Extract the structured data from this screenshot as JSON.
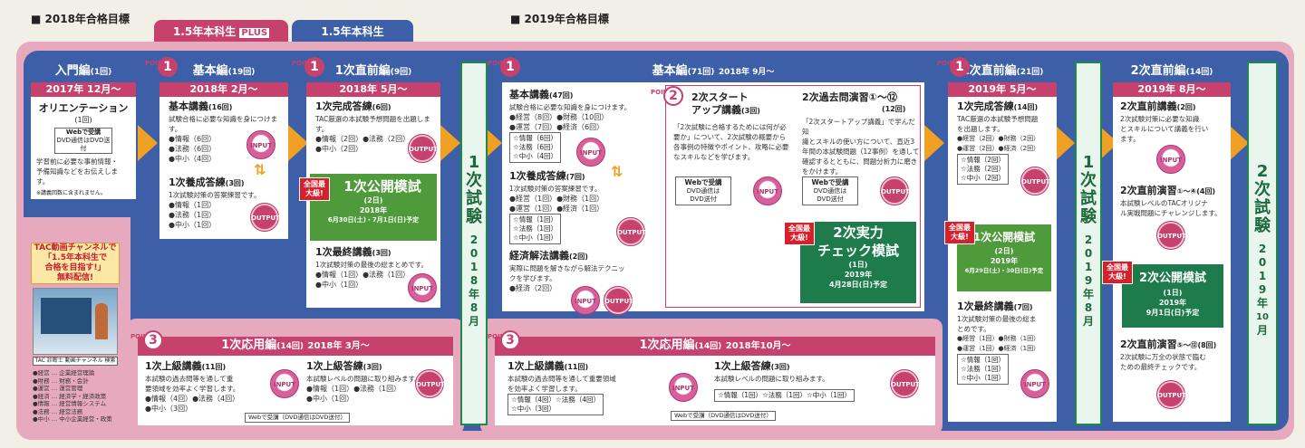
{
  "headers": {
    "h2018": "■ 2018年合格目標",
    "h2019": "■ 2019年合格目標"
  },
  "tabs": {
    "plus_pre": "1.5年本科生",
    "plus_badge": "PLUS",
    "basic": "1.5年本科生"
  },
  "point_label": "POINT",
  "icons": {
    "input": "INPUT",
    "output": "OUTPUT"
  },
  "nyumon": {
    "title": "入門編",
    "count": "(1回)",
    "date": "2017年 12月～",
    "sub_title": "オリエンテーション",
    "sub_count": "(1回)",
    "web": "Webで受講",
    "web2": "DVD通信はDVD送付",
    "desc1": "学習前に必要な事前情報・",
    "desc2": "予備知識などをお伝えします。",
    "note": "※講義回数に含まれません。"
  },
  "kiso2018": {
    "point": "1",
    "title": "基本編",
    "count": "(19回)",
    "date": "2018年 2月～",
    "lec_title": "基本講義",
    "lec_count": "(16回)",
    "lec_desc": "試験合格に必要な知識を身につけます。",
    "lec_items": [
      "●情報（6回）",
      "●法務（6回）",
      "●中小（4回）"
    ],
    "ans_title": "1次養成答練",
    "ans_count": "(3回)",
    "ans_desc": "1次試験対策の答案練習です。",
    "ans_items": [
      "●情報（1回）",
      "●法務（1回）",
      "●中小（1回）"
    ]
  },
  "chokuzen2018": {
    "point": "1",
    "title": "1次直前編",
    "count": "(9回)",
    "date": "2018年 5月～",
    "t1": "1次完成答練",
    "c1": "(6回)",
    "d1": "TAC厳選の本試験予想問題を出題します。",
    "i1": "●情報（2回）●法務（2回）",
    "i1b": "●中小（2回）",
    "mock_tag": "全国最大級!",
    "mock": "1次公開模試",
    "mock_count": "(2日)",
    "mock_year": "2018年",
    "mock_date": "6月30日(土)・7月1日(日)予定",
    "t2": "1次最終講義",
    "c2": "(3回)",
    "d2": "1次試験対策の最後の総まとめです。",
    "i2": "●情報（1回）●法務（1回）",
    "i2b": "●中小（1回）"
  },
  "exam1_2018": {
    "a": "1",
    "b": "次",
    "c": "試",
    "d": "験",
    "e": "2",
    "f": "0",
    "g": "1",
    "h": "8",
    "i": "年",
    "j": "8",
    "k": "月"
  },
  "kiso2019": {
    "point": "1",
    "title": "基本編",
    "count": "(71回)",
    "date": "2018年 9月～",
    "t1": "基本講義",
    "c1": "(47回)",
    "d1": "試験合格に必要な知識を身につけます。",
    "i1": "●経営（8回）●財務（10回）",
    "i1b": "●運営（7回）●経済（6回）",
    "bx1": [
      "☆情報（6回）",
      "☆法務（6回）",
      "☆中小（4回）"
    ],
    "t2": "1次養成答練",
    "c2": "(7回)",
    "d2": "1次試験対策の答案練習です。",
    "i2": "●経営（1回）●財務（1回）",
    "i2b": "●運営（1回）●経済（1回）",
    "bx2": [
      "☆情報（1回）",
      "☆法務（1回）",
      "☆中小（1回）"
    ],
    "t3": "経済解法講義",
    "c3": "(2回)",
    "d3a": "実際に問題を解きながら解法テクニッ",
    "d3b": "クを学びます。",
    "i3": "●経済（2回）",
    "p2": "2",
    "st_title": "2次スタート",
    "st_title2": "アップ講義",
    "st_count": "(3回)",
    "st_d": [
      "「2次試験に合格するためには何が必",
      "要か」について、2次試験の概要から",
      "各事例の特徴やポイント、攻略に必要",
      "なスキルなどを学びます。"
    ],
    "web": "Webで受講",
    "web2": "DVD通信は",
    "web3": "DVD送付",
    "kk_title": "2次過去問演習①～⑫",
    "kk_count": "(12回)",
    "kk_d": [
      "「2次スタートアップ講義」で学んだ知",
      "識とスキルの使い方について、直近3",
      "年間の本試験問題（12事例）を通して",
      "確認するとともに、問題分析力に磨き",
      "をかけます。"
    ],
    "j_tag": "全国最大級!",
    "j1": "2次実力",
    "j2": "チェック模試",
    "j_count": "(1日)",
    "j_year": "2019年",
    "j_date": "4月28日(日)予定"
  },
  "chokuzen2019": {
    "point": "1",
    "title": "1次直前編",
    "count": "(21回)",
    "date": "2019年 5月～",
    "t1": "1次完成答練",
    "c1": "(14回)",
    "d1": [
      "TAC厳選の本試験予想問題",
      "を出題します。"
    ],
    "i1": "●経営（2回）●財務（2回）",
    "i1b": "●運営（2回）●経済（2回）",
    "bx1": [
      "☆情報（2回）",
      "☆法務（2回）",
      "☆中小（2回）"
    ],
    "mock_tag": "全国最大級!",
    "mock": "1次公開模試",
    "mock_count": "(2日)",
    "mock_year": "2019年",
    "mock_date": "6月29日(土)・30日(日)予定",
    "t2": "1次最終講義",
    "c2": "(7回)",
    "d2": [
      "1次試験対策の最後の総ま",
      "とめです。"
    ],
    "i2": "●経営（1回）●財務（1回）",
    "i2b": "●運営（1回）●経済（1回）",
    "bx2": [
      "☆情報（1回）",
      "☆法務（1回）",
      "☆中小（1回）"
    ]
  },
  "exam1_2019": {
    "a": "1",
    "b": "次",
    "c": "試",
    "d": "験",
    "e": "2",
    "f": "0",
    "g": "1",
    "h": "9",
    "i": "年",
    "j": "8",
    "k": "月"
  },
  "niji": {
    "title": "2次直前編",
    "count": "(14回)",
    "date": "2019年 8月～",
    "t1": "2次直前講義",
    "c1": "(2回)",
    "d1": [
      "2次試験対策に必要な知識",
      "とスキルについて講義を行い",
      "ます。"
    ],
    "t2": "2次直前演習",
    "t2b": "①～④",
    "c2": "(4回)",
    "d2": [
      "本試験レベルのTACオリジナ",
      "ル実戦問題にチャレンジします。"
    ],
    "mock_tag": "全国最大級!",
    "mock": "2次公開模試",
    "mock_count": "(1日)",
    "mock_year": "2019年",
    "mock_date": "9月1日(日)予定",
    "t3": "2次直前演習",
    "t3b": "⑤～⑫",
    "c3": "(8回)",
    "d3": [
      "2次試験に万全の状態で臨む",
      "ための最終チェックです。"
    ]
  },
  "exam2": {
    "a": "2",
    "b": "次",
    "c": "試",
    "d": "験",
    "e": "2",
    "f": "0",
    "g": "1",
    "h": "9",
    "i": "年",
    "j": "10",
    "k": "月"
  },
  "ouyou2018": {
    "point": "3",
    "title": "1次応用編",
    "count": "(14回)",
    "date": "2018年 3月～",
    "t1": "1次上級講義",
    "c1": "(11回)",
    "d1": [
      "本試験の過去問等を通して重",
      "要領域を効率よく学習します。"
    ],
    "i1": "●情報（4回）●法務（4回）",
    "i1b": "●中小（3回）",
    "t2": "1次上級答練",
    "c2": "(3回)",
    "d2": "本試験レベルの問題に取り組みます。",
    "i2": "●情報（1回）●法務（1回）",
    "i2b": "●中小（1回）",
    "web": "Webで受講（DVD通信はDVD送付）"
  },
  "ouyou2019": {
    "point": "3",
    "title": "1次応用編",
    "count": "(14回)",
    "date": "2018年10月～",
    "t1": "1次上級講義",
    "c1": "(11回)",
    "d1": [
      "本試験の過去問等を通して重要領域",
      "を効率よく学習します。"
    ],
    "bx1": [
      "☆情報（4回）☆法務（4回）",
      "☆中小（3回）"
    ],
    "t2": "1次上級答練",
    "c2": "(3回)",
    "d2": "本試験レベルの問題に取り組みます。",
    "bx2": "☆情報（1回）☆法務（1回）☆中小（1回）",
    "web": "Webで受講（DVD通信はDVD送付）"
  },
  "promo": {
    "l1": "TAC動画チャンネルで",
    "l2": "「1.5年本科生で",
    "l3": "合格を目指す!」",
    "l4": "無料配信!",
    "caption": "TAC 診断士 動画チャンネル 検索"
  },
  "legend": [
    "●経営 … 企業経営理論",
    "●財務 … 財務・会計",
    "●運営 … 運営管理",
    "●経済 … 経済学・経済政策",
    "●情報 … 経営情報システム",
    "●法務 … 経営法務",
    "●中小 … 中小企業経営・政策"
  ],
  "colors": {
    "blue": "#3d5fa8",
    "pink": "#c6416b",
    "orange": "#f0a023",
    "green": "#4f9a3b",
    "darkgreen": "#1e7b4b"
  }
}
